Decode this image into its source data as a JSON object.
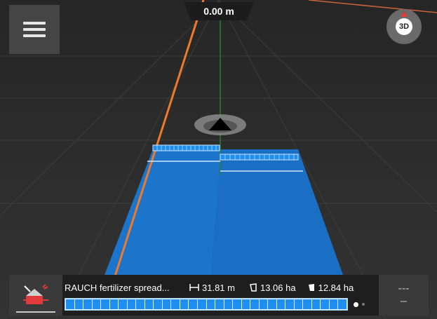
{
  "header": {
    "distance_value": "0.00 m",
    "view_mode_label": "3D"
  },
  "colors": {
    "background": "#2b2b2b",
    "coverage": "#1a6fc4",
    "guidance_line": "#f07a2a",
    "section_active": "#1e8ff0"
  },
  "icons": {
    "menu": "hamburger-menu-icon",
    "view": "3d-compass-icon",
    "implement": "fertilizer-spreader-icon",
    "vehicle": "vehicle-arrow-icon",
    "working_width": "working-width-icon",
    "area_total": "area-total-icon",
    "area_worked": "area-worked-icon"
  },
  "status_bar": {
    "implement_name": "RAUCH fertilizer spread...",
    "working_width": "31.81 m",
    "area_total": "13.06 ha",
    "area_worked": "12.84 ha",
    "section_count": 32,
    "right_button_top": "---",
    "right_button_bottom": "–"
  }
}
